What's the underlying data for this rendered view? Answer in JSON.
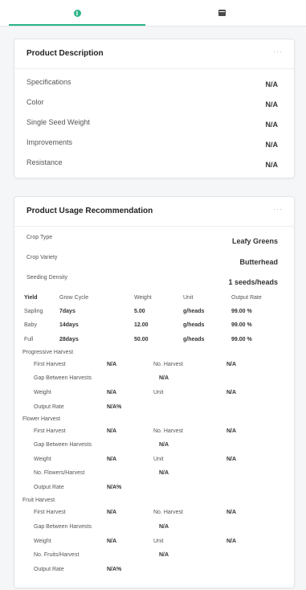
{
  "tabs": {
    "info_icon": "info-icon",
    "calendar_icon": "calendar-icon",
    "accent": "#2bb389"
  },
  "description": {
    "title": "Product Description",
    "menu": "···",
    "rows": [
      {
        "label": "Specifications",
        "value": "N/A"
      },
      {
        "label": "Color",
        "value": "N/A"
      },
      {
        "label": "Single Seed Weight",
        "value": "N/A"
      },
      {
        "label": "Improvements",
        "value": "N/A"
      },
      {
        "label": "Resistance",
        "value": "N/A"
      }
    ]
  },
  "usage": {
    "title": "Product Usage Recommendation",
    "menu": "···",
    "crop_type_label": "Crop Type",
    "crop_type_value": "Leafy Greens",
    "crop_variety_label": "Crop Variety",
    "crop_variety_value": "Butterhead",
    "seeding_density_label": "Seeding Density",
    "seeding_density_value": "1 seeds/heads",
    "yield_table": {
      "headers": [
        "Yield",
        "Grow Cycle",
        "Weight",
        "Unit",
        "Output Rate"
      ],
      "rows": [
        [
          "Sapling",
          "7days",
          "5.00",
          "g/heads",
          "99.00 %"
        ],
        [
          "Baby",
          "14days",
          "12.00",
          "g/heads",
          "99.00 %"
        ],
        [
          "Full",
          "28days",
          "50.00",
          "g/heads",
          "99.00 %"
        ]
      ]
    },
    "progressive": {
      "title": "Progressive Harvest",
      "first_harvest_label": "First Harvest",
      "first_harvest_value": "N/A",
      "no_harvest_label": "No. Harvest",
      "no_harvest_value": "N/A",
      "gap_label": "Gap Between Harvests",
      "gap_value": "N/A",
      "weight_label": "Weight",
      "weight_value": "N/A",
      "unit_label": "Unit",
      "unit_value": "N/A",
      "output_rate_label": "Output Rate",
      "output_rate_value": "N/A%"
    },
    "flower": {
      "title": "Flower Harvest",
      "first_harvest_label": "First Harvest",
      "first_harvest_value": "N/A",
      "no_harvest_label": "No. Harvest",
      "no_harvest_value": "N/A",
      "gap_label": "Gap Between Harvests",
      "gap_value": "N/A",
      "weight_label": "Weight",
      "weight_value": "N/A",
      "unit_label": "Unit",
      "unit_value": "N/A",
      "per_harvest_label": "No. Flowers/Harvest",
      "per_harvest_value": "N/A",
      "output_rate_label": "Output Rate",
      "output_rate_value": "N/A%"
    },
    "fruit": {
      "title": "Fruit Harvest",
      "first_harvest_label": "First Harvest",
      "first_harvest_value": "N/A",
      "no_harvest_label": "No. Harvest",
      "no_harvest_value": "N/A",
      "gap_label": "Gap Between Harvests",
      "gap_value": "N/A",
      "weight_label": "Weight",
      "weight_value": "N/A",
      "unit_label": "Unit",
      "unit_value": "N/A",
      "per_harvest_label": "No. Fruits/Harvest",
      "per_harvest_value": "N/A",
      "output_rate_label": "Output Rate",
      "output_rate_value": "N/A%"
    }
  }
}
